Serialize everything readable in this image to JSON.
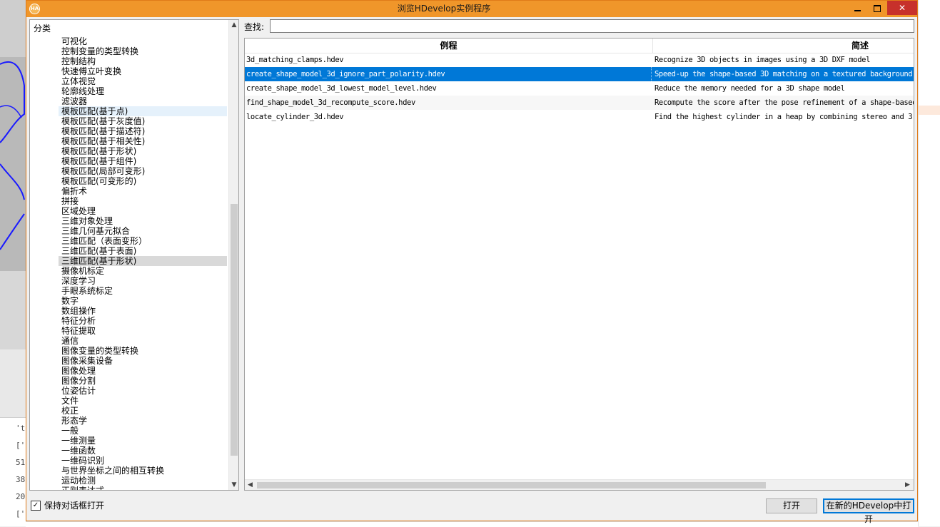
{
  "window": {
    "title": "浏览HDevelop实例程序",
    "app_icon": "HA",
    "minimize_icon": "minimize-icon",
    "maximize_icon": "maximize-icon",
    "close_glyph": "✕"
  },
  "category_tree": {
    "header": "分类",
    "items": [
      "可视化",
      "控制变量的类型转换",
      "控制结构",
      "快速傅立叶变换",
      "立体视觉",
      "轮廓线处理",
      "滤波器",
      "模板匹配(基于点)",
      "模板匹配(基于灰度值)",
      "模板匹配(基于描述符)",
      "模板匹配(基于相关性)",
      "模板匹配(基于形状)",
      "模板匹配(基于组件)",
      "模板匹配(局部可变形)",
      "模板匹配(可变形的)",
      "偏折术",
      "拼接",
      "区域处理",
      "三维对象处理",
      "三维几何基元拟合",
      "三维匹配（表面变形）",
      "三维匹配(基于表面)",
      "三维匹配(基于形状)",
      "摄像机标定",
      "深度学习",
      "手眼系统标定",
      "数字",
      "数组操作",
      "特征分析",
      "特征提取",
      "通信",
      "图像变量的类型转换",
      "图像采集设备",
      "图像处理",
      "图像分割",
      "位姿估计",
      "文件",
      "校正",
      "形态学",
      "一般",
      "一维测量",
      "一维函数",
      "一维码识别",
      "与世界坐标之间的相互转换",
      "运动检测",
      "正则表达式"
    ],
    "hover_item": "模板匹配(基于点)",
    "selected_item": "三维匹配(基于形状)"
  },
  "search": {
    "label": "查找:",
    "value": ""
  },
  "examples_table": {
    "columns": [
      "例程",
      "简述"
    ],
    "rows": [
      {
        "file": "3d_matching_clamps.hdev",
        "desc": "Recognize 3D objects in images using a 3D DXF model"
      },
      {
        "file": "create_shape_model_3d_ignore_part_polarity.hdev",
        "desc": "Speed-up the shape-based 3D matching on a textured background"
      },
      {
        "file": "create_shape_model_3d_lowest_model_level.hdev",
        "desc": "Reduce the memory needed for a 3D shape model"
      },
      {
        "file": "find_shape_model_3d_recompute_score.hdev",
        "desc": "Recompute the score after the pose refinement of a shape-based"
      },
      {
        "file": "locate_cylinder_3d.hdev",
        "desc": "Find the highest cylinder in a heap by combining stereo and 3"
      }
    ],
    "selected_row": 1
  },
  "footer": {
    "keep_open_label": "保持对话框打开",
    "keep_open_checked": true,
    "open_button": "打开",
    "open_new_button": "在新的HDevelop中打开"
  },
  "background": {
    "console_lines": [
      "'t",
      "['",
      "51",
      "38",
      "20",
      "['"
    ]
  },
  "colors": {
    "titlebar": "#f0962a",
    "selection": "#0078d7",
    "close_button": "#c7312b"
  }
}
